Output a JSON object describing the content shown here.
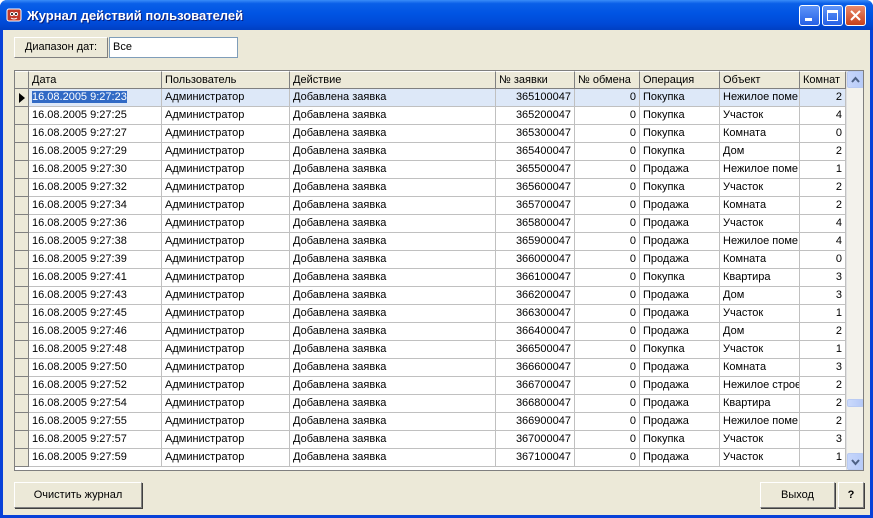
{
  "window": {
    "title": "Журнал действий пользователей"
  },
  "filter": {
    "label": "Диапазон дат:",
    "value": "Все"
  },
  "grid": {
    "columns": [
      "Дата",
      "Пользователь",
      "Действие",
      "№ заявки",
      "№ обмена",
      "Операция",
      "Объект",
      "Комнат"
    ],
    "rows": [
      [
        "16.08.2005 9:27:23",
        "Администратор",
        "Добавлена заявка",
        "365100047",
        "0",
        "Покупка",
        "Нежилое поме",
        "2"
      ],
      [
        "16.08.2005 9:27:25",
        "Администратор",
        "Добавлена заявка",
        "365200047",
        "0",
        "Покупка",
        "Участок",
        "4"
      ],
      [
        "16.08.2005 9:27:27",
        "Администратор",
        "Добавлена заявка",
        "365300047",
        "0",
        "Покупка",
        "Комната",
        "0"
      ],
      [
        "16.08.2005 9:27:29",
        "Администратор",
        "Добавлена заявка",
        "365400047",
        "0",
        "Покупка",
        "Дом",
        "2"
      ],
      [
        "16.08.2005 9:27:30",
        "Администратор",
        "Добавлена заявка",
        "365500047",
        "0",
        "Продажа",
        "Нежилое поме",
        "1"
      ],
      [
        "16.08.2005 9:27:32",
        "Администратор",
        "Добавлена заявка",
        "365600047",
        "0",
        "Покупка",
        "Участок",
        "2"
      ],
      [
        "16.08.2005 9:27:34",
        "Администратор",
        "Добавлена заявка",
        "365700047",
        "0",
        "Продажа",
        "Комната",
        "2"
      ],
      [
        "16.08.2005 9:27:36",
        "Администратор",
        "Добавлена заявка",
        "365800047",
        "0",
        "Продажа",
        "Участок",
        "4"
      ],
      [
        "16.08.2005 9:27:38",
        "Администратор",
        "Добавлена заявка",
        "365900047",
        "0",
        "Продажа",
        "Нежилое поме",
        "4"
      ],
      [
        "16.08.2005 9:27:39",
        "Администратор",
        "Добавлена заявка",
        "366000047",
        "0",
        "Продажа",
        "Комната",
        "0"
      ],
      [
        "16.08.2005 9:27:41",
        "Администратор",
        "Добавлена заявка",
        "366100047",
        "0",
        "Покупка",
        "Квартира",
        "3"
      ],
      [
        "16.08.2005 9:27:43",
        "Администратор",
        "Добавлена заявка",
        "366200047",
        "0",
        "Продажа",
        "Дом",
        "3"
      ],
      [
        "16.08.2005 9:27:45",
        "Администратор",
        "Добавлена заявка",
        "366300047",
        "0",
        "Продажа",
        "Участок",
        "1"
      ],
      [
        "16.08.2005 9:27:46",
        "Администратор",
        "Добавлена заявка",
        "366400047",
        "0",
        "Продажа",
        "Дом",
        "2"
      ],
      [
        "16.08.2005 9:27:48",
        "Администратор",
        "Добавлена заявка",
        "366500047",
        "0",
        "Покупка",
        "Участок",
        "1"
      ],
      [
        "16.08.2005 9:27:50",
        "Администратор",
        "Добавлена заявка",
        "366600047",
        "0",
        "Продажа",
        "Комната",
        "3"
      ],
      [
        "16.08.2005 9:27:52",
        "Администратор",
        "Добавлена заявка",
        "366700047",
        "0",
        "Продажа",
        "Нежилое строе",
        "2"
      ],
      [
        "16.08.2005 9:27:54",
        "Администратор",
        "Добавлена заявка",
        "366800047",
        "0",
        "Продажа",
        "Квартира",
        "2"
      ],
      [
        "16.08.2005 9:27:55",
        "Администратор",
        "Добавлена заявка",
        "366900047",
        "0",
        "Продажа",
        "Нежилое поме",
        "2"
      ],
      [
        "16.08.2005 9:27:57",
        "Администратор",
        "Добавлена заявка",
        "367000047",
        "0",
        "Покупка",
        "Участок",
        "3"
      ],
      [
        "16.08.2005 9:27:59",
        "Администратор",
        "Добавлена заявка",
        "367100047",
        "0",
        "Продажа",
        "Участок",
        "1"
      ]
    ],
    "selected_row": 0,
    "scroll_position": 0.87
  },
  "buttons": {
    "clear": "Очистить журнал",
    "exit": "Выход",
    "help": "?"
  },
  "colors": {
    "title_bar": "#0054e3",
    "selection": "#316ac5",
    "window_bg": "#ece9d8"
  }
}
